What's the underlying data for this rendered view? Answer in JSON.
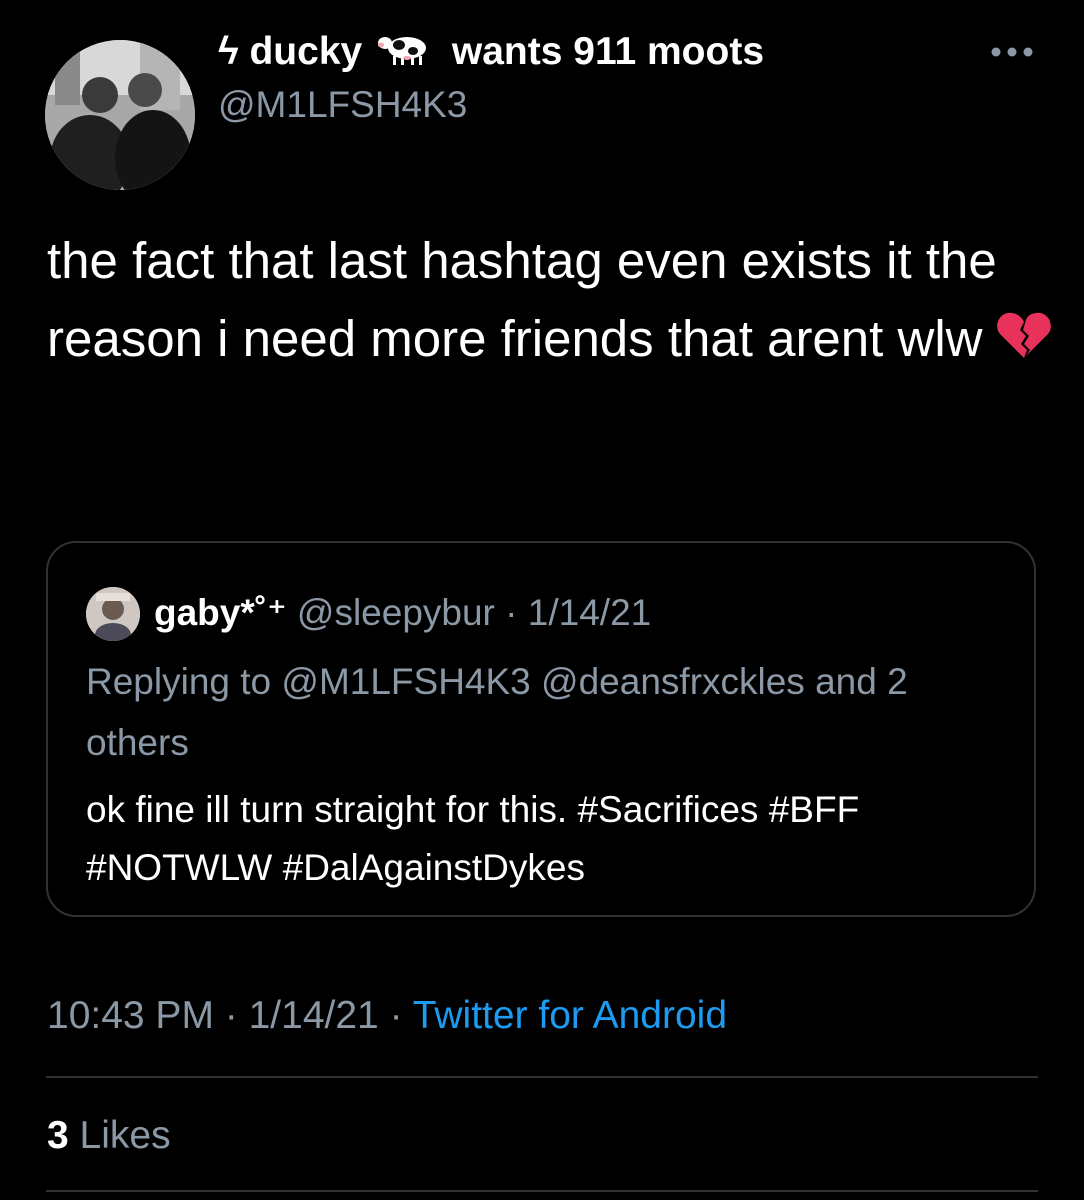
{
  "author": {
    "name_prefix": "ϟ ducky",
    "name_suffix": "wants 911 moots",
    "handle": "@M1LFSH4K3",
    "avatar_icon": "avatar-photo-icon",
    "name_emoji": "cow-icon"
  },
  "menu": {
    "icon": "more-options-icon"
  },
  "tweet": {
    "text": "the fact that last hashtag even exists it the reason i need more friends that arent wlw",
    "emoji": "broken-heart-icon"
  },
  "quote": {
    "name": "gaby*˚⁺",
    "handle": "@sleepybur",
    "date": "1/14/21",
    "separator": " · ",
    "replying_to": "Replying to @M1LFSH4K3 @deansfrxckles and 2 others",
    "text": "ok fine ill turn straight for this. #Sacrifices #BFF #NOTWLW #DalAgainstDykes"
  },
  "meta": {
    "time": "10:43 PM",
    "date": "1/14/21",
    "separator": " · ",
    "source": "Twitter for Android"
  },
  "stats": {
    "likes_count": "3",
    "likes_label": "Likes"
  },
  "colors": {
    "background": "#000000",
    "text": "#ffffff",
    "secondary_text": "#8b98a5",
    "link": "#1d9bf0",
    "border": "#2f3336"
  }
}
